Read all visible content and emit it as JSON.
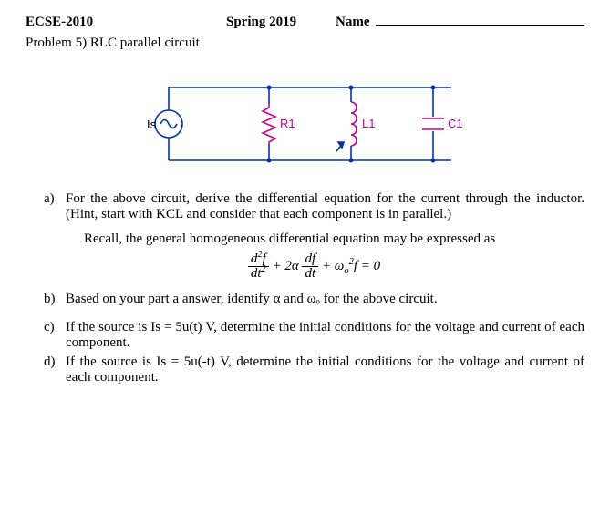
{
  "header": {
    "course": "ECSE-2010",
    "term": "Spring 2019",
    "name_label": "Name"
  },
  "problem_title": "Problem 5) RLC parallel circuit",
  "circuit": {
    "source_label": "Is",
    "r_label": "R1",
    "l_label": "L1",
    "c_label": "C1"
  },
  "parts": {
    "a_label": "a)",
    "a_text": "For the above circuit, derive the differential equation for the current through the inductor. (Hint, start with KCL and consider that each component is in parallel.)",
    "recall": "Recall, the general homogeneous differential equation may be expressed as",
    "b_label": "b)",
    "b_text": "Based on your part a answer, identify α and ωₒ for the above circuit.",
    "c_label": "c)",
    "c_text": "If the source is Is = 5u(t) V, determine the initial conditions for the voltage and current of each component.",
    "d_label": "d)",
    "d_text": "If the source is Is = 5u(-t) V, determine the initial conditions for the voltage and current of each component."
  }
}
